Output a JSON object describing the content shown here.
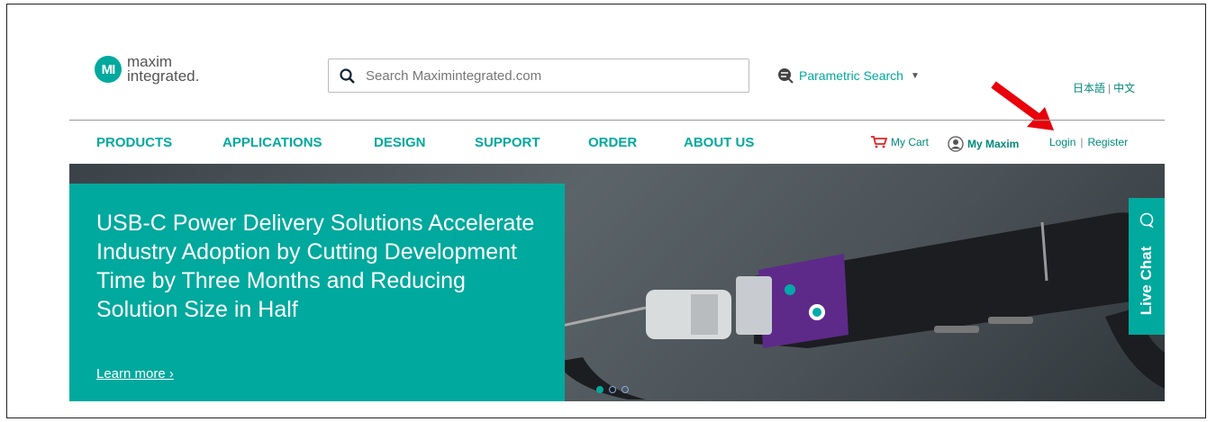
{
  "header": {
    "logo_line1": "maxim",
    "logo_line2": "integrated.",
    "logo_mark": "MI",
    "search_placeholder": "Search Maximintegrated.com",
    "parametric_label": "Parametric Search",
    "lang_ja": "日本語",
    "lang_zh": "中文"
  },
  "nav": {
    "items": [
      "PRODUCTS",
      "APPLICATIONS",
      "DESIGN",
      "SUPPORT",
      "ORDER",
      "ABOUT US"
    ]
  },
  "util": {
    "cart": "My Cart",
    "my_maxim": "My Maxim",
    "login": "Login",
    "register": "Register"
  },
  "hero": {
    "title": "USB-C Power Delivery Solutions Accelerate Industry Adoption by Cutting Development Time by Three Months and Reducing Solution Size in Half",
    "link": "Learn more ›",
    "slide_count": 3,
    "active_slide": 1
  },
  "livechat": {
    "label": "Live Chat"
  },
  "colors": {
    "brand": "#00a99d",
    "annotation_arrow": "#e8000b"
  }
}
